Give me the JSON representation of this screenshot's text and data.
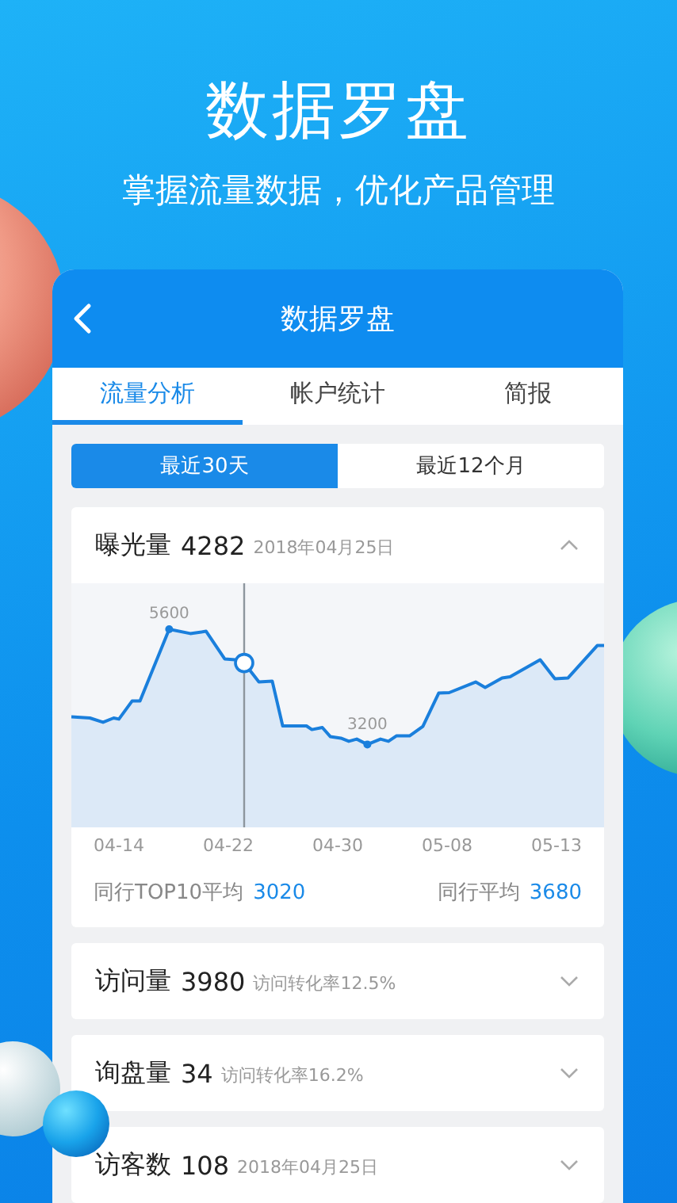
{
  "hero": {
    "title": "数据罗盘",
    "subtitle": "掌握流量数据，优化产品管理"
  },
  "nav": {
    "title": "数据罗盘"
  },
  "tabs": [
    {
      "label": "流量分析",
      "selected": true
    },
    {
      "label": "帐户统计",
      "selected": false
    },
    {
      "label": "简报",
      "selected": false
    }
  ],
  "range_toggle": [
    {
      "label": "最近30天",
      "selected": true
    },
    {
      "label": "最近12个月",
      "selected": false
    }
  ],
  "metrics": [
    {
      "name": "曝光量",
      "value": "4282",
      "note": "2018年04月25日",
      "expanded": true,
      "chart": {
        "point_labels": [
          "5600",
          "3200"
        ],
        "x_labels": [
          "04-14",
          "04-22",
          "04-30",
          "05-08",
          "05-13"
        ]
      },
      "footer": [
        {
          "label": "同行TOP10平均",
          "value": "3020"
        },
        {
          "label": "同行平均",
          "value": "3680"
        }
      ]
    },
    {
      "name": "访问量",
      "value": "3980",
      "note": "访问转化率12.5%",
      "expanded": false
    },
    {
      "name": "询盘量",
      "value": "34",
      "note": "访问转化率16.2%",
      "expanded": false
    },
    {
      "name": "访客数",
      "value": "108",
      "note": "2018年04月25日",
      "expanded": false
    }
  ]
}
